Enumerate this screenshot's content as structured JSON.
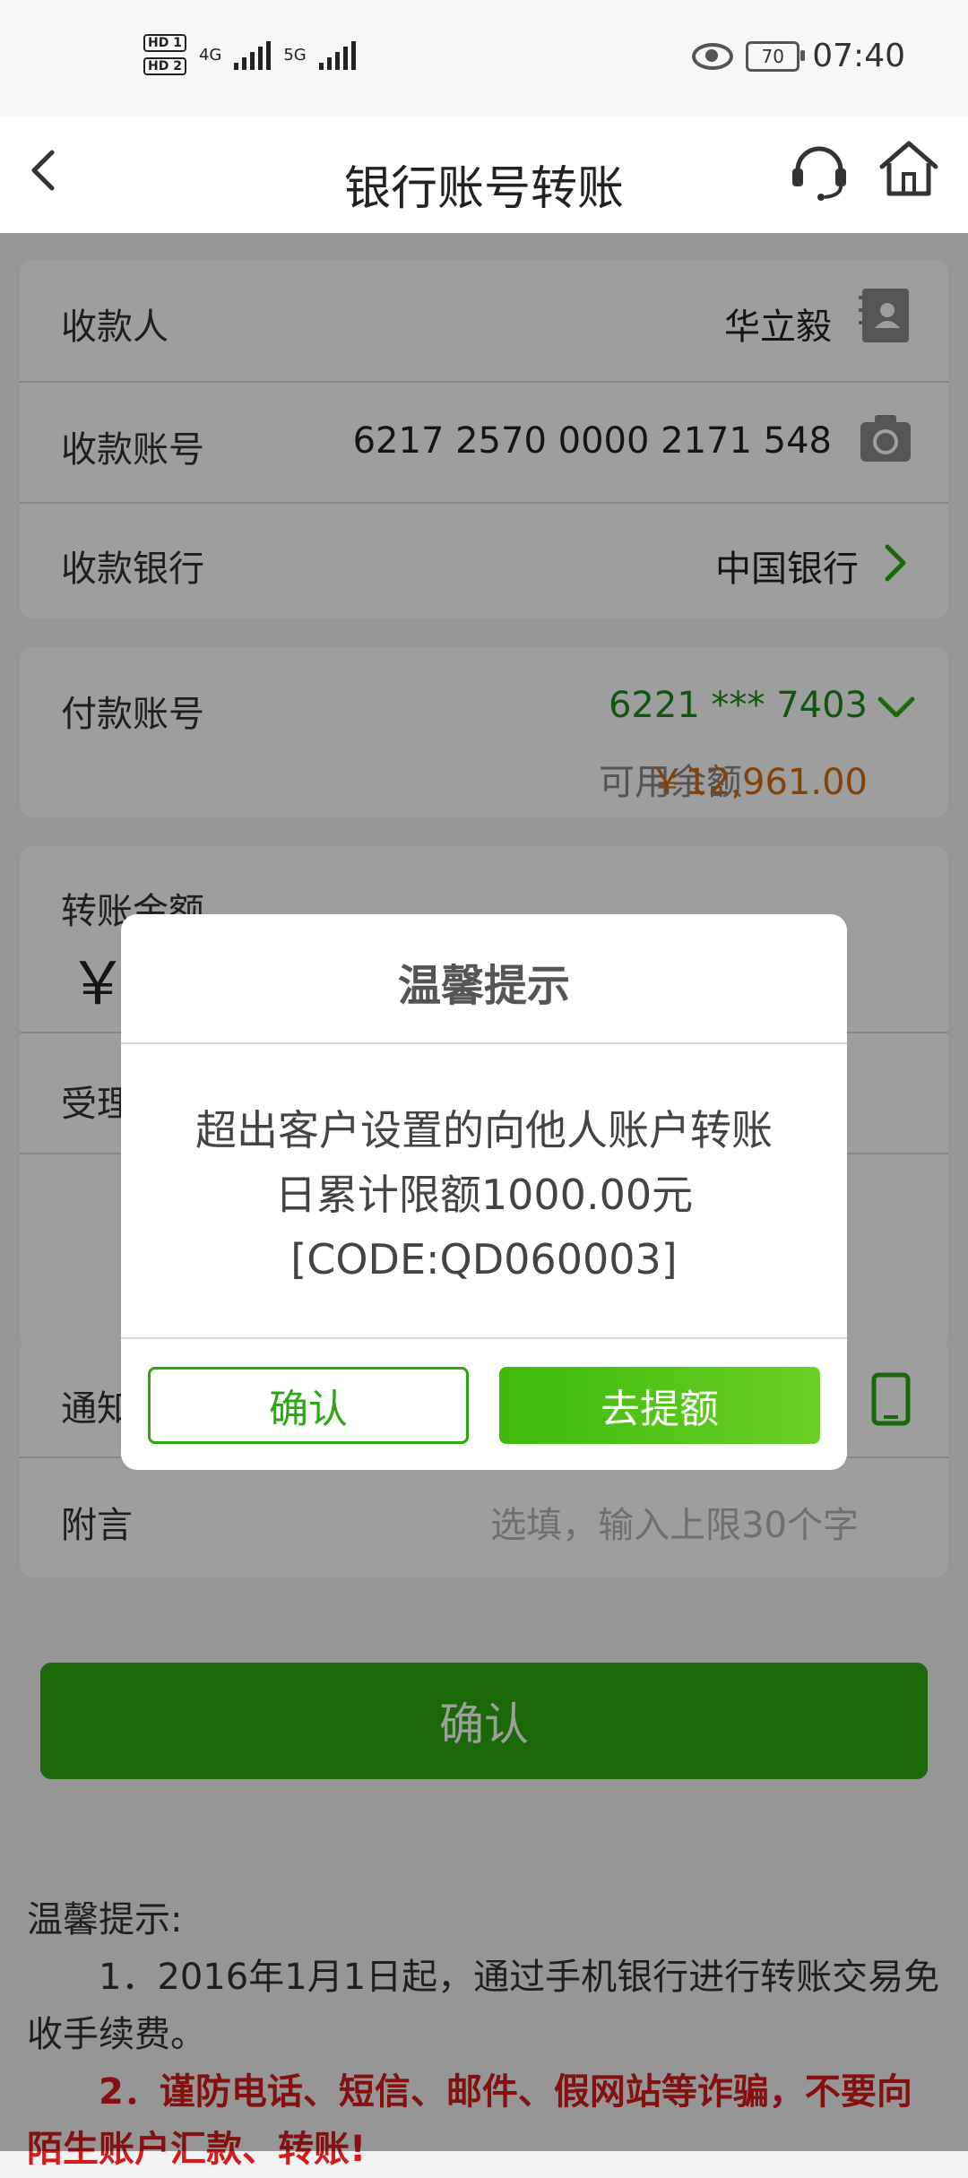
{
  "status_bar": {
    "hd1": "HD 1",
    "hd2": "HD 2",
    "net1": "4G",
    "net2": "5G",
    "battery": "70",
    "time": "07:40"
  },
  "header": {
    "title": "银行账号转账"
  },
  "payee": {
    "label": "收款人",
    "value": "华立毅"
  },
  "account": {
    "label": "收款账号",
    "value": "6217 2570 0000 2171 548"
  },
  "bank": {
    "label": "收款银行",
    "value": "中国银行"
  },
  "payer": {
    "label": "付款账号",
    "value": "6221 *** 7403",
    "balance_label": "可用余额",
    "balance": "￥12,961.00"
  },
  "amount": {
    "label": "转账金额",
    "currency": "￥"
  },
  "accept": {
    "label_fragment": "受理"
  },
  "notify": {
    "label_fragment": "通知"
  },
  "remark": {
    "label": "附言",
    "placeholder": "选填，输入上限30个字"
  },
  "confirm_button": "确认",
  "tips": {
    "title": "温馨提示:",
    "item1": "1．2016年1月1日起，通过手机银行进行转账交易免收手续费。",
    "item2": "2．谨防电话、短信、邮件、假网站等诈骗，不要向陌生账户汇款、转账!"
  },
  "dialog": {
    "title": "温馨提示",
    "line1": "超出客户设置的向他人账户转账",
    "line2": "日累计限额1000.00元",
    "line3": "[CODE:QD060003]",
    "confirm_label": "确认",
    "raise_label": "去提额"
  },
  "colors": {
    "accent_green": "#2da810",
    "balance_orange": "#d36c0e",
    "warning_red": "#d51b1b"
  }
}
